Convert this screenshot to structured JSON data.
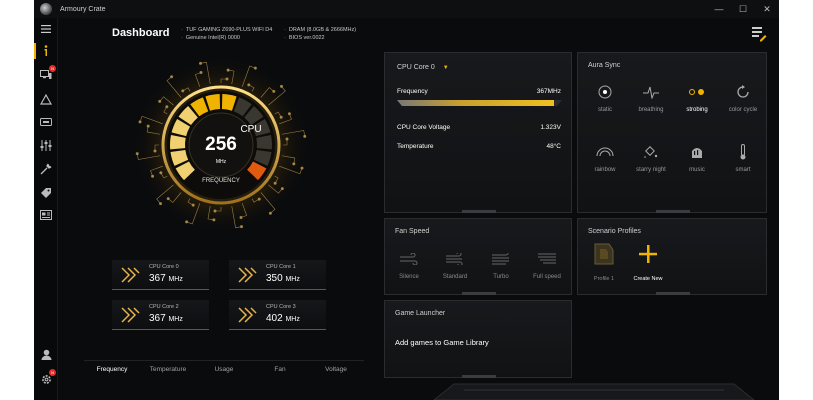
{
  "app": {
    "title": "Armoury Crate"
  },
  "window_controls": {
    "minimize": "—",
    "maximize": "☐",
    "close": "✕"
  },
  "header": {
    "title": "Dashboard",
    "board": "TUF GAMING Z690-PLUS WIFI D4",
    "cpu": "Genuine Intel(R) 0000",
    "dram": "DRAM (8.0GB & 2666MHz)",
    "bios": "BIOS ver.0022"
  },
  "sidebar": {
    "items": [
      {
        "icon": "menu-icon"
      },
      {
        "icon": "info-icon",
        "active": true
      },
      {
        "icon": "devices-icon",
        "badge": "N"
      },
      {
        "icon": "aura-icon"
      },
      {
        "icon": "gamevisual-icon"
      },
      {
        "icon": "settings-sliders-icon"
      },
      {
        "icon": "tools-icon"
      },
      {
        "icon": "tag-icon"
      },
      {
        "icon": "news-icon"
      }
    ],
    "bottom": [
      {
        "icon": "user-icon"
      },
      {
        "icon": "gear-icon",
        "badge": "N"
      }
    ]
  },
  "gauge": {
    "label": "CPU",
    "value": "256",
    "unit": "MHz",
    "mode": "FREQUENCY",
    "level": 0.6
  },
  "cores": [
    {
      "name": "CPU Core 0",
      "value": "367",
      "unit": "MHz"
    },
    {
      "name": "CPU Core 1",
      "value": "350",
      "unit": "MHz"
    },
    {
      "name": "CPU Core 2",
      "value": "367",
      "unit": "MHz"
    },
    {
      "name": "CPU Core 3",
      "value": "402",
      "unit": "MHz"
    }
  ],
  "bottom_tabs": [
    "Frequency",
    "Temperature",
    "Usage",
    "Fan",
    "Voltage"
  ],
  "cpu_panel": {
    "selector": "CPU Core 0",
    "frequency_label": "Frequency",
    "frequency_value": "367MHz",
    "frequency_level": 0.95,
    "voltage_label": "CPU Core Voltage",
    "voltage_value": "1.323V",
    "temp_label": "Temperature",
    "temp_value": "48°C"
  },
  "aura": {
    "title": "Aura Sync",
    "modes": [
      {
        "label": "static",
        "icon": "static-icon"
      },
      {
        "label": "breathing",
        "icon": "breathing-icon"
      },
      {
        "label": "strobing",
        "icon": "strobing-icon",
        "active": true
      },
      {
        "label": "color cycle",
        "icon": "color-cycle-icon"
      },
      {
        "label": "rainbow",
        "icon": "rainbow-icon"
      },
      {
        "label": "starry night",
        "icon": "starry-night-icon"
      },
      {
        "label": "music",
        "icon": "music-icon"
      },
      {
        "label": "smart",
        "icon": "smart-icon"
      }
    ],
    "accent": "#f0b400"
  },
  "fan": {
    "title": "Fan Speed",
    "modes": [
      {
        "label": "Silence",
        "icon": "fan-silence-icon"
      },
      {
        "label": "Standard",
        "icon": "fan-standard-icon"
      },
      {
        "label": "Turbo",
        "icon": "fan-turbo-icon"
      },
      {
        "label": "Full speed",
        "icon": "fan-fullspeed-icon"
      }
    ]
  },
  "scenario": {
    "title": "Scenario Profiles",
    "profiles": [
      {
        "label": "Profile 1",
        "icon": "profile-icon"
      },
      {
        "label": "Create New",
        "icon": "plus-icon"
      }
    ]
  },
  "game_launcher": {
    "title": "Game Launcher",
    "text": "Add games to Game Library"
  }
}
